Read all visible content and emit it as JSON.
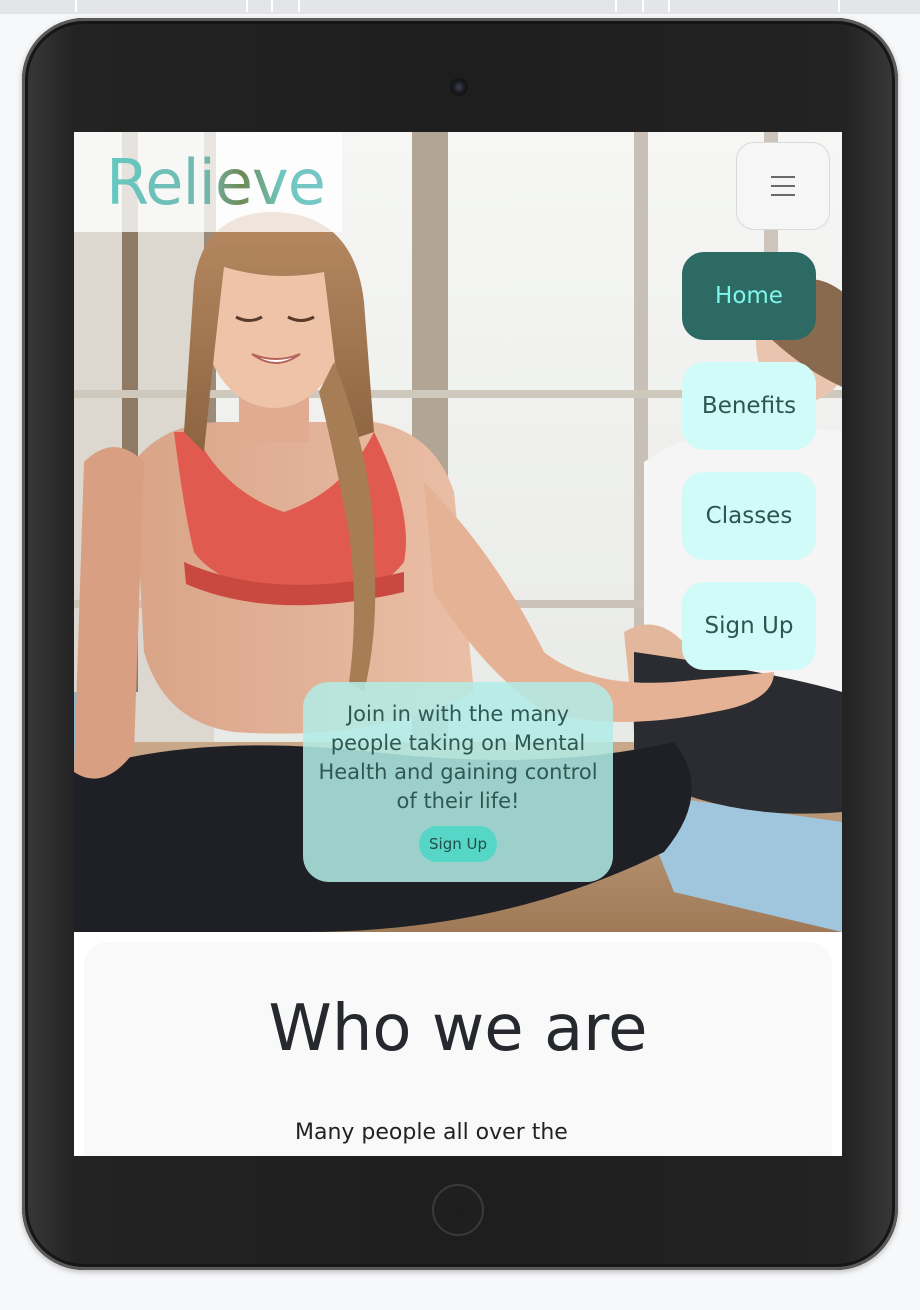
{
  "brand": {
    "logo_text": "Relieve"
  },
  "nav": {
    "menu_icon": "hamburger-icon",
    "items": [
      {
        "label": "Home",
        "active": true
      },
      {
        "label": "Benefits",
        "active": false
      },
      {
        "label": "Classes",
        "active": false
      },
      {
        "label": "Sign Up",
        "active": false
      }
    ]
  },
  "hero": {
    "cta_text": "Join in with the many people taking on Mental Health and gaining control of their life!",
    "cta_button": "Sign Up"
  },
  "who": {
    "title": "Who we are",
    "body": "Many people all over the"
  },
  "colors": {
    "accent_dark": "#2d6a63",
    "accent_light": "#d1fbf8",
    "cta_button": "#56d6c7",
    "active_text": "#7ff7ea"
  }
}
